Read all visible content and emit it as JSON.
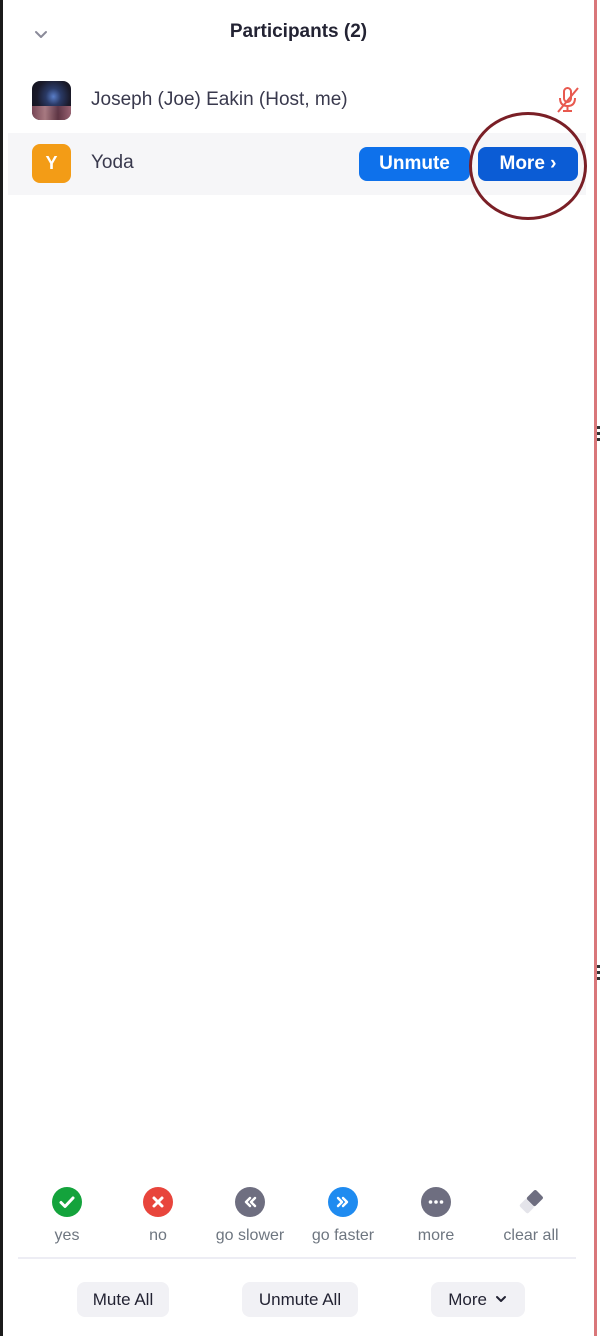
{
  "panel": {
    "title": "Participants (2)",
    "collapse_icon": "chevron-down-icon"
  },
  "participants": [
    {
      "name": "Joseph (Joe) Eakin (Host, me)",
      "avatar": "photo",
      "status_icon": "microphone-muted-icon",
      "status_color": "#e8594f"
    },
    {
      "name": "Yoda",
      "avatar_initial": "Y",
      "avatar_color": "#f39c16",
      "actions": [
        {
          "label": "Unmute"
        },
        {
          "label": "More ›"
        }
      ]
    }
  ],
  "reactions": [
    {
      "label": "yes",
      "icon": "checkmark-icon",
      "color": "#14a33c"
    },
    {
      "label": "no",
      "icon": "x-icon",
      "color": "#e8453c"
    },
    {
      "label": "go slower",
      "icon": "rewind-icon",
      "color": "#6e6e80"
    },
    {
      "label": "go faster",
      "icon": "fast-forward-icon",
      "color": "#1f8bf0"
    },
    {
      "label": "more",
      "icon": "ellipsis-icon",
      "color": "#6e6e80"
    },
    {
      "label": "clear all",
      "icon": "eraser-icon",
      "color": "#6e6e80"
    }
  ],
  "footer": {
    "mute_all": "Mute All",
    "unmute_all": "Unmute All",
    "more": "More"
  },
  "colors": {
    "accent": "#0e71eb",
    "annotation": "#7a1f26"
  }
}
